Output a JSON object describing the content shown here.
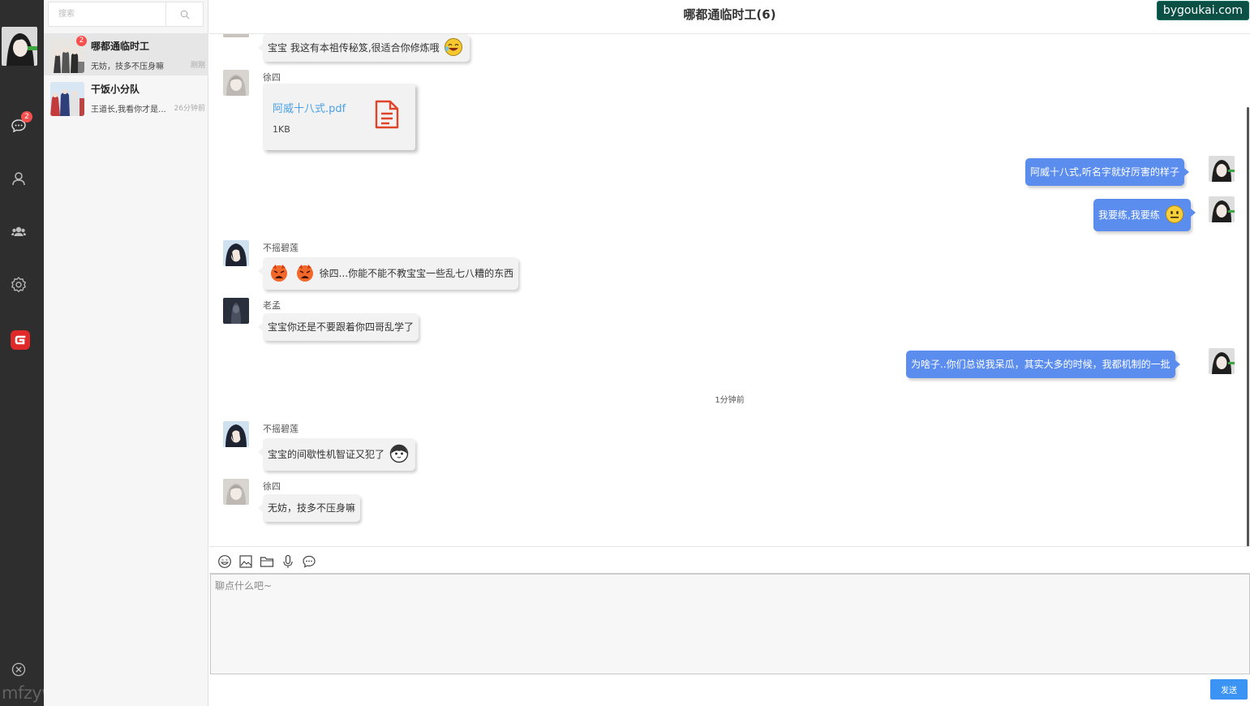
{
  "sidebar": {
    "unread_badge": "2",
    "icons": [
      "chat-icon",
      "contacts-icon",
      "group-icon",
      "settings-icon",
      "brand-logo",
      "exit-icon"
    ],
    "watermark": "mfzyw.xyz"
  },
  "conversation_list": {
    "search_placeholder": "搜索",
    "items": [
      {
        "name": "哪都通临时工",
        "last_message": "无妨，技多不压身嘛",
        "time": "刚刚",
        "badge": "2",
        "active": true
      },
      {
        "name": "干饭小分队",
        "last_message": "王道长,我看你才是...",
        "time": "26分钟前",
        "badge": "",
        "active": false
      }
    ]
  },
  "chat": {
    "title": "哪都通临时工(6)",
    "watermark": "bygoukai.com",
    "messages": [
      {
        "side": "left",
        "sender": "",
        "text": "宝宝 我这有本祖传秘笈,很适合你修炼哦"
      },
      {
        "side": "left",
        "sender": "徐四",
        "type": "file",
        "file_name": "阿威十八式.pdf",
        "file_size": "1KB"
      },
      {
        "side": "right",
        "text": "阿威十八式,听名字就好厉害的样子"
      },
      {
        "side": "right",
        "text": "我要练,我要练"
      },
      {
        "side": "left",
        "sender": "不摇碧莲",
        "text": "徐四...你能不能不教宝宝一些乱七八糟的东西"
      },
      {
        "side": "left",
        "sender": "老孟",
        "text": "宝宝你还是不要跟着你四哥乱学了"
      },
      {
        "side": "right",
        "text": "为啥子..你们总说我呆瓜，其实大多的时候，我都机制的一批"
      },
      {
        "side": "left",
        "sender": "不摇碧莲",
        "text": "宝宝的间歇性机智证又犯了"
      },
      {
        "side": "left",
        "sender": "徐四",
        "text": "无妨，技多不压身嘛"
      }
    ],
    "time_divider": "1分钟前"
  },
  "composer": {
    "tools": [
      "emoji-icon",
      "image-icon",
      "folder-icon",
      "microphone-icon",
      "chat-bubble-icon"
    ],
    "placeholder": "聊点什么吧~",
    "send_label": "发送"
  },
  "colors": {
    "rail_bg": "#2e2e2e",
    "bubble_self": "#5b8def",
    "bubble_other": "#f2f2f2",
    "badge": "#f5504d",
    "send_button": "#3b93f4"
  }
}
